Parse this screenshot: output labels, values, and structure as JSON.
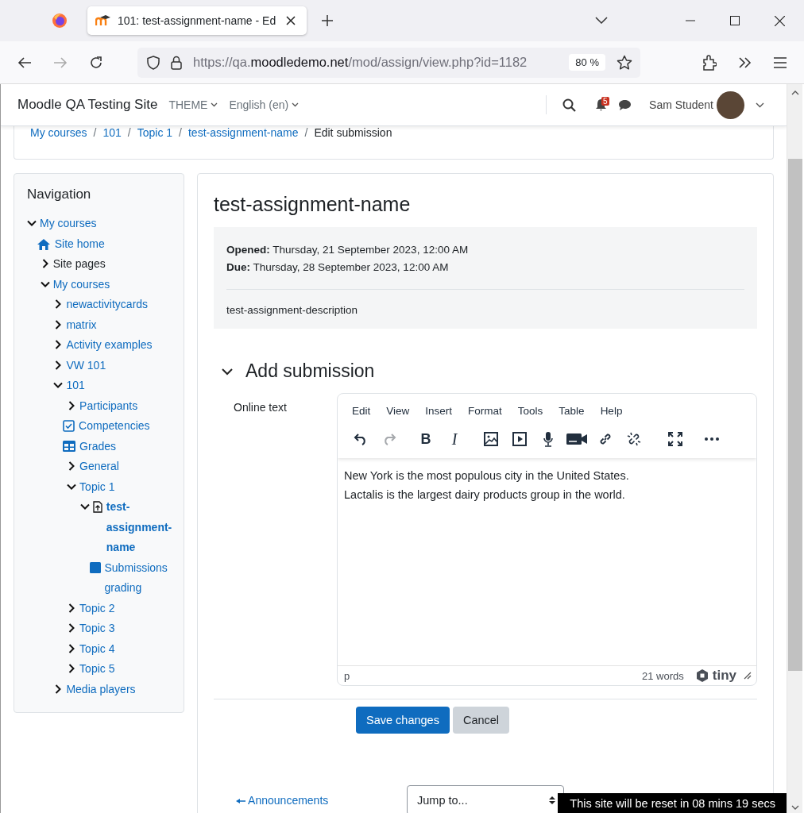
{
  "browser": {
    "tab_title": "101: test-assignment-name - Ed",
    "url": {
      "scheme": "https://qa.",
      "domain": "moodledemo.net",
      "path": "/mod/assign/view.php?id=1182"
    },
    "zoom": "80 %",
    "forward_disabled": true
  },
  "navbar": {
    "site_name": "Moodle QA Testing Site",
    "menus": [
      "THEME",
      "English (en)"
    ],
    "notification_count": "5",
    "user_name": "Sam Student"
  },
  "breadcrumb": {
    "separator": "/",
    "items": [
      {
        "label": "My courses",
        "link": true
      },
      {
        "label": "101",
        "link": true
      },
      {
        "label": "Topic 1",
        "link": true
      },
      {
        "label": "test-assignment-name",
        "link": true
      },
      {
        "label": "Edit submission",
        "link": false
      }
    ]
  },
  "navigation": {
    "title": "Navigation",
    "items": [
      {
        "label": "My courses",
        "kind": "branch",
        "expanded": true,
        "children": [
          {
            "label": "Site home",
            "kind": "home"
          },
          {
            "label": "Site pages",
            "kind": "category",
            "expanded": false
          },
          {
            "label": "My courses",
            "kind": "branch",
            "expanded": true,
            "children": [
              {
                "label": "newactivitycards",
                "kind": "branch",
                "expanded": false
              },
              {
                "label": "matrix",
                "kind": "branch",
                "expanded": false
              },
              {
                "label": "Activity examples",
                "kind": "branch",
                "expanded": false
              },
              {
                "label": "VW 101",
                "kind": "branch",
                "expanded": false
              },
              {
                "label": "101",
                "kind": "branch",
                "expanded": true,
                "children": [
                  {
                    "label": "Participants",
                    "kind": "branch",
                    "expanded": false
                  },
                  {
                    "label": "Competencies",
                    "kind": "competencies"
                  },
                  {
                    "label": "Grades",
                    "kind": "grades"
                  },
                  {
                    "label": "General",
                    "kind": "branch",
                    "expanded": false
                  },
                  {
                    "label": "Topic 1",
                    "kind": "branch",
                    "expanded": true,
                    "children": [
                      {
                        "label": "test-assignment-name",
                        "kind": "assignment",
                        "expanded": true,
                        "children": [
                          {
                            "label": "Submissions grading",
                            "kind": "report"
                          }
                        ]
                      }
                    ]
                  },
                  {
                    "label": "Topic 2",
                    "kind": "branch",
                    "expanded": false
                  },
                  {
                    "label": "Topic 3",
                    "kind": "branch",
                    "expanded": false
                  },
                  {
                    "label": "Topic 4",
                    "kind": "branch",
                    "expanded": false
                  },
                  {
                    "label": "Topic 5",
                    "kind": "branch",
                    "expanded": false
                  }
                ]
              },
              {
                "label": "Media players",
                "kind": "branch",
                "expanded": false
              }
            ]
          }
        ]
      }
    ]
  },
  "assignment": {
    "title": "test-assignment-name",
    "dates": [
      "**Opened:** Thursday, 21 September 2023, 12:00 AM",
      "**Due:** Thursday, 28 September 2023, 12:00 AM"
    ],
    "description": "test-assignment-description"
  },
  "submission": {
    "heading": "Add submission",
    "expanded": true,
    "field_label": "Online text",
    "editor": {
      "menus": [
        "Edit",
        "View",
        "Insert",
        "Format",
        "Tools",
        "Table",
        "Help"
      ],
      "toolbar": [
        [
          {
            "kind": "undo",
            "disabled": false
          },
          {
            "kind": "redo",
            "disabled": true
          }
        ],
        [
          {
            "kind": "bold",
            "glyph": "B",
            "disabled": false
          },
          {
            "kind": "italic",
            "glyph": "I",
            "disabled": false
          }
        ],
        [
          {
            "kind": "image",
            "disabled": false
          },
          {
            "kind": "media",
            "disabled": false
          },
          {
            "kind": "microphone",
            "disabled": false
          },
          {
            "kind": "camera",
            "disabled": false
          },
          {
            "kind": "link",
            "disabled": false
          },
          {
            "kind": "unlink",
            "disabled": false
          }
        ],
        [
          {
            "kind": "fullscreen",
            "disabled": false
          }
        ],
        [
          {
            "kind": "more",
            "disabled": false
          }
        ]
      ],
      "paragraphs": [
        "New York is the most populous city in the United States.",
        "Lactalis is the largest dairy products group in the world."
      ],
      "element_path": "p",
      "word_count": "21 words",
      "brand": "tiny"
    }
  },
  "buttons": [
    {
      "label": "Save changes",
      "kind": "primary"
    },
    {
      "label": "Cancel",
      "kind": "secondary"
    }
  ],
  "footer": {
    "previous_link": "Announcements",
    "jump_placeholder": "Jump to..."
  },
  "reset_notice": "This site will be reset in 08 mins 19 secs"
}
